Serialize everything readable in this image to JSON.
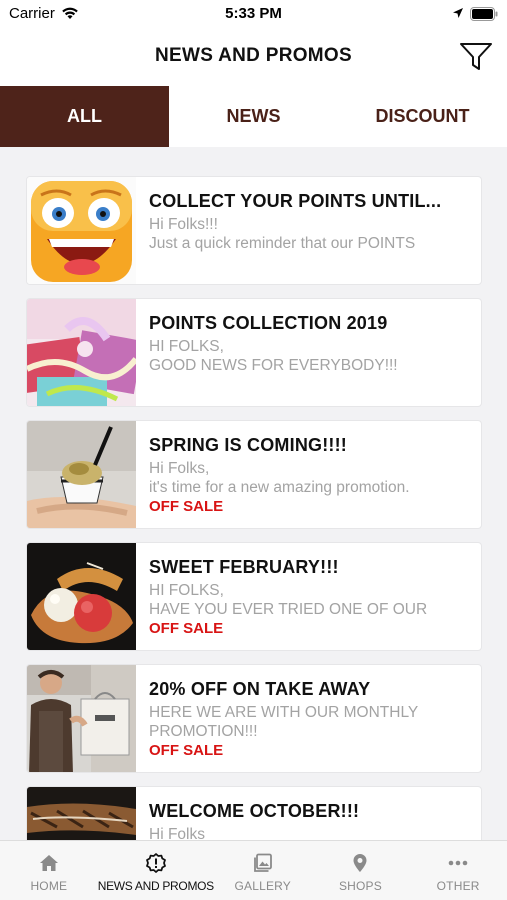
{
  "status": {
    "carrier": "Carrier",
    "time": "5:33 PM"
  },
  "header": {
    "title": "NEWS AND PROMOS",
    "filter_icon": "funnel-icon"
  },
  "tabs": [
    {
      "label": "ALL",
      "active": true
    },
    {
      "label": "NEWS",
      "active": false
    },
    {
      "label": "DISCOUNT",
      "active": false
    }
  ],
  "news": [
    {
      "title": "COLLECT YOUR POINTS UNTIL...",
      "line1": "Hi Folks!!!",
      "line2": "Just a quick reminder that our POINTS",
      "badge": ""
    },
    {
      "title": "POINTS COLLECTION 2019",
      "line1": "HI FOLKS,",
      "line2": "GOOD NEWS FOR EVERYBODY!!!",
      "badge": ""
    },
    {
      "title": "SPRING IS COMING!!!!",
      "line1": "Hi Folks,",
      "line2": "it's time for a new amazing promotion.",
      "badge": "OFF SALE"
    },
    {
      "title": "SWEET FEBRUARY!!!",
      "line1": "HI FOLKS,",
      "line2": "HAVE YOU EVER TRIED ONE OF OUR",
      "badge": "OFF SALE"
    },
    {
      "title": "20% OFF ON TAKE AWAY",
      "line1": "HERE WE ARE WITH OUR MONTHLY",
      "line2": "PROMOTION!!!",
      "badge": "OFF SALE"
    },
    {
      "title": "WELCOME OCTOBER!!!",
      "line1": "Hi Folks",
      "line2": "",
      "badge": ""
    }
  ],
  "tabbar": [
    {
      "label": "HOME",
      "icon": "home-icon",
      "active": false
    },
    {
      "label": "NEWS AND PROMOS",
      "icon": "alert-badge-icon",
      "active": true
    },
    {
      "label": "GALLERY",
      "icon": "gallery-icon",
      "active": false
    },
    {
      "label": "SHOPS",
      "icon": "location-pin-icon",
      "active": false
    },
    {
      "label": "OTHER",
      "icon": "more-dots-icon",
      "active": false
    }
  ],
  "colors": {
    "brand_brown": "#4e231a",
    "sale_red": "#d81414",
    "muted_text": "#a3a3a3"
  }
}
